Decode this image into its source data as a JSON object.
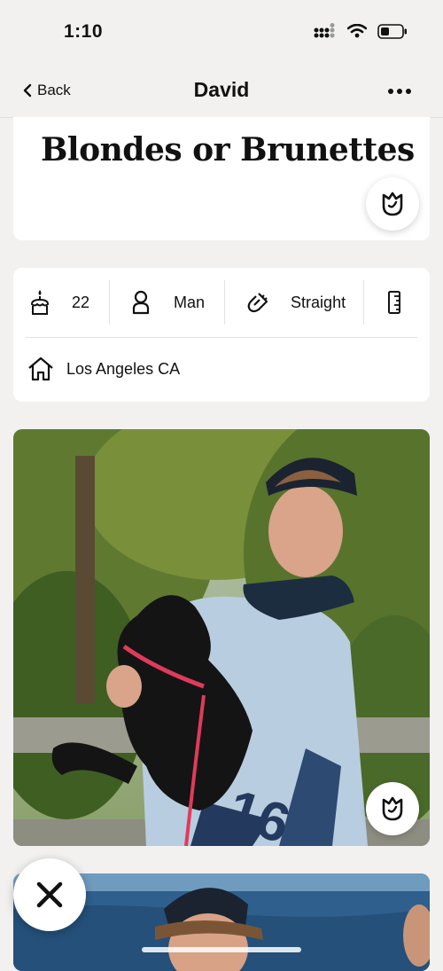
{
  "status_bar": {
    "time": "1:10"
  },
  "nav": {
    "back_label": "Back",
    "title": "David"
  },
  "prompt": {
    "answer": "Blondes or Brunettes"
  },
  "vitals": {
    "age": "22",
    "gender": "Man",
    "orientation": "Straight",
    "location": "Los Angeles CA"
  },
  "icons": [
    "signal-icon",
    "wifi-icon",
    "battery-icon",
    "chevron-left-icon",
    "more-icon",
    "rose-icon",
    "cake-icon",
    "person-icon",
    "magnet-icon",
    "ruler-icon",
    "home-icon",
    "close-icon"
  ],
  "colors": {
    "background": "#f2f1f0",
    "card": "#ffffff",
    "text": "#111111"
  }
}
